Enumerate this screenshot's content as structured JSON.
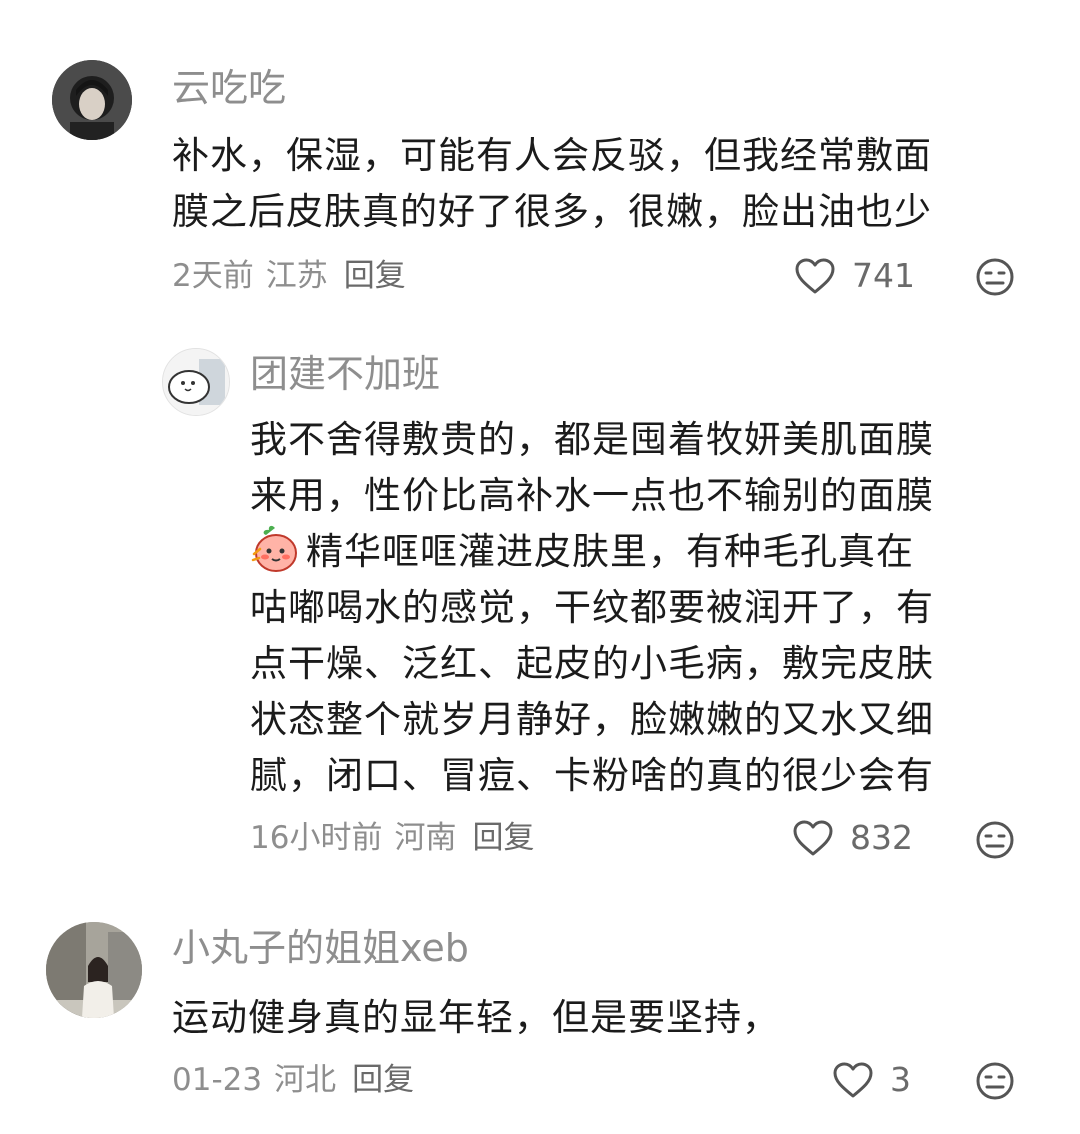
{
  "comments": [
    {
      "username": "云吃吃",
      "text_lines": [
        "补水，保湿，可能有人会反驳，但我经常敷面",
        "膜之后皮肤真的好了很多，很嫩，脸出油也少"
      ],
      "time": "2天前",
      "location": "江苏",
      "reply_label": "回复",
      "likes": "741",
      "avatar": "avatar-dark-hair-girl",
      "replies": [
        {
          "username": "团建不加班",
          "text_lines": [
            "我不舍得敷贵的，都是囤着牧妍美肌面膜",
            "来用，性价比高补水一点也不输别的面膜",
            "精华哐哐灌进皮肤里，有种毛孔真在",
            "咕嘟喝水的感觉，干纹都要被润开了，有",
            "点干燥、泛红、起皮的小毛病，敷完皮肤",
            "状态整个就岁月静好，脸嫩嫩的又水又细",
            "腻，闭口、冒痘、卡粉啥的真的很少会有"
          ],
          "inline_emoji": "shy-peach-emoji",
          "time": "16小时前",
          "location": "河南",
          "reply_label": "回复",
          "likes": "832",
          "avatar": "avatar-cartoon-seal"
        }
      ]
    },
    {
      "username": "小丸子的姐姐xeb",
      "text_lines": [
        "运动健身真的显年轻，但是要坚持，"
      ],
      "time": "01-23",
      "location": "河北",
      "reply_label": "回复",
      "likes": "3",
      "avatar": "avatar-photo-woman"
    }
  ],
  "icons": {
    "like": "heart-outline-icon",
    "dislike": "meh-face-icon"
  },
  "colors": {
    "meta_gray": "#8e8e8e",
    "text": "#1b1b1b",
    "icon_gray": "#555555"
  }
}
